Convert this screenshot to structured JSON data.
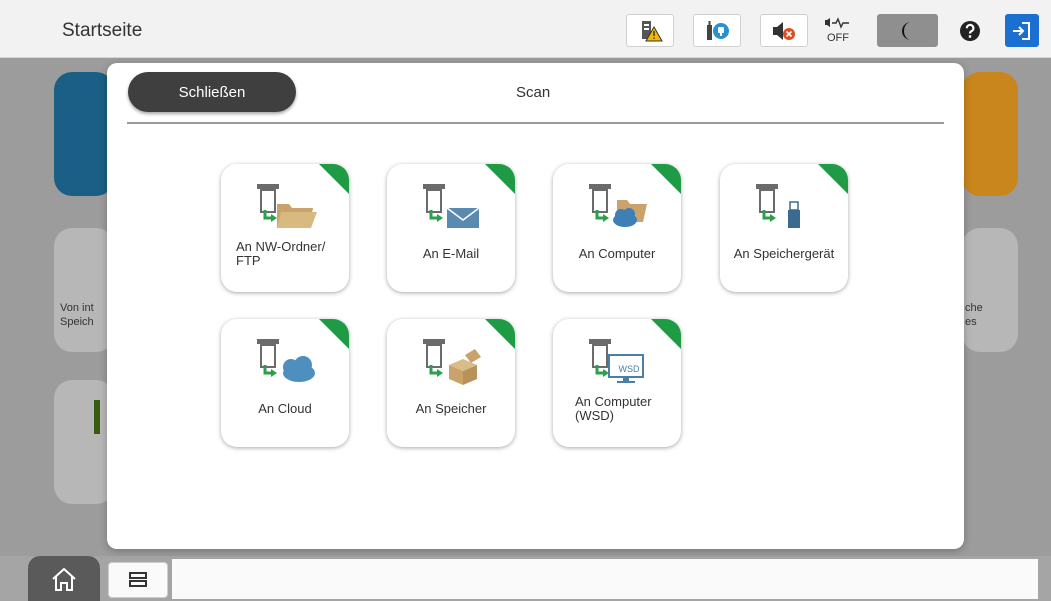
{
  "header": {
    "title": "Startseite",
    "status_icons": [
      {
        "name": "toner-warning-icon"
      },
      {
        "name": "maintenance-icon"
      },
      {
        "name": "sound-muted-icon"
      },
      {
        "name": "quiet-mode-off-icon",
        "label": "OFF"
      },
      {
        "name": "sleep-mode-icon"
      },
      {
        "name": "help-icon"
      },
      {
        "name": "login-icon"
      }
    ]
  },
  "modal": {
    "close_label": "Schließen",
    "title": "Scan",
    "tiles": [
      {
        "name": "scan-to-nw-folder-tile",
        "line1": "An NW-Ordner/",
        "line2": "FTP",
        "icon": "folder-icon"
      },
      {
        "name": "scan-to-email-tile",
        "line1": "An E-Mail",
        "icon": "envelope-icon"
      },
      {
        "name": "scan-to-computer-tile",
        "line1": "An Computer",
        "icon": "computer-cloud-folder-icon"
      },
      {
        "name": "scan-to-storage-device-tile",
        "line1": "An Speichergerät",
        "icon": "usb-drive-icon"
      },
      {
        "name": "scan-to-cloud-tile",
        "line1": "An Cloud",
        "icon": "cloud-icon"
      },
      {
        "name": "scan-to-storage-tile",
        "line1": "An Speicher",
        "icon": "box-icon"
      },
      {
        "name": "scan-to-computer-wsd-tile",
        "line1": "An Computer",
        "line2": "(WSD)",
        "icon": "monitor-wsd-icon",
        "icon_text": "WSD"
      }
    ]
  },
  "background": {
    "left_tiles": [
      "Von int",
      "Speich"
    ],
    "right_tiles": [
      "che",
      "es"
    ]
  },
  "colors": {
    "accent_green": "#1f9a45",
    "login_blue": "#1a6fd1"
  }
}
